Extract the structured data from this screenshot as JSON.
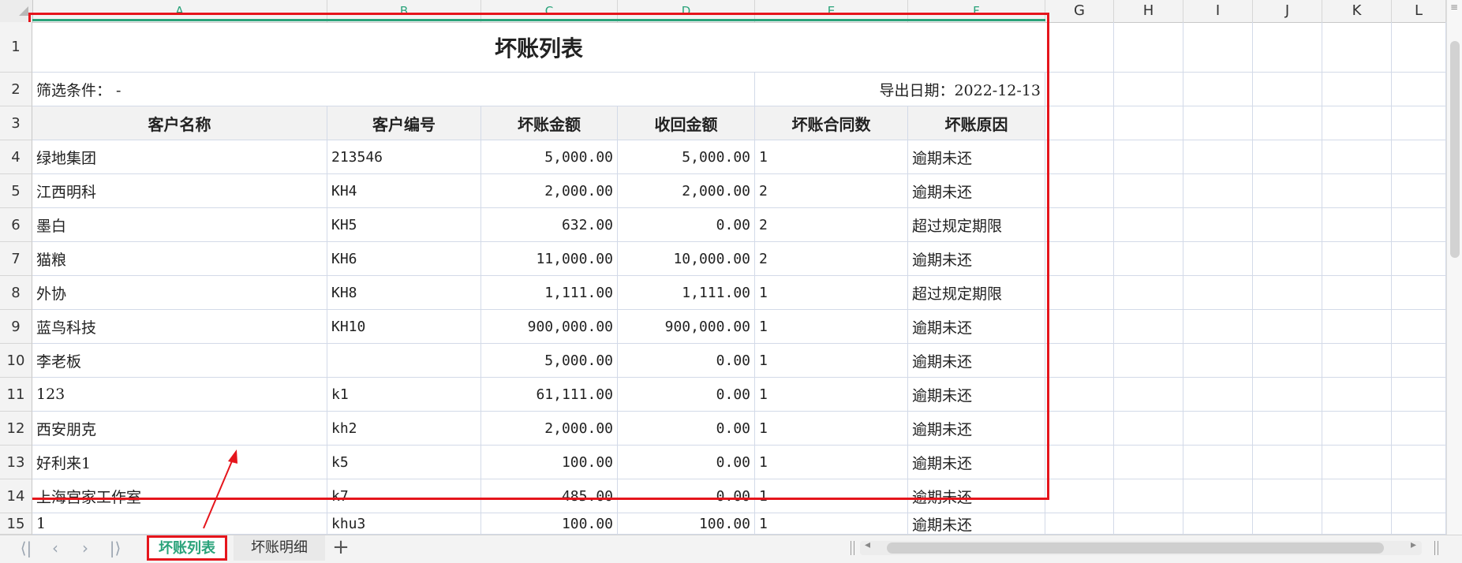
{
  "columns": [
    "A",
    "B",
    "C",
    "D",
    "E",
    "F",
    "G",
    "H",
    "I",
    "J",
    "K",
    "L"
  ],
  "rows": [
    "1",
    "2",
    "3",
    "4",
    "5",
    "6",
    "7",
    "8",
    "9",
    "10",
    "11",
    "12",
    "13",
    "14",
    "15"
  ],
  "report": {
    "title": "坏账列表",
    "filter_label": "筛选条件： -",
    "export_date_label": "导出日期：2022-12-13",
    "headers": [
      "客户名称",
      "客户编号",
      "坏账金额",
      "收回金额",
      "坏账合同数",
      "坏账原因"
    ],
    "records": [
      [
        "绿地集团",
        "213546",
        "5,000.00",
        "5,000.00",
        "1",
        "逾期未还"
      ],
      [
        "江西明科",
        "KH4",
        "2,000.00",
        "2,000.00",
        "2",
        "逾期未还"
      ],
      [
        "墨白",
        "KH5",
        "632.00",
        "0.00",
        "2",
        "超过规定期限"
      ],
      [
        "猫粮",
        "KH6",
        "11,000.00",
        "10,000.00",
        "2",
        "逾期未还"
      ],
      [
        "外协",
        "KH8",
        "1,111.00",
        "1,111.00",
        "1",
        "超过规定期限"
      ],
      [
        "蓝鸟科技",
        "KH10",
        "900,000.00",
        "900,000.00",
        "1",
        "逾期未还"
      ],
      [
        "李老板",
        "",
        "5,000.00",
        "0.00",
        "1",
        "逾期未还"
      ],
      [
        "123",
        "k1",
        "61,111.00",
        "0.00",
        "1",
        "逾期未还"
      ],
      [
        "西安朋克",
        "kh2",
        "2,000.00",
        "0.00",
        "1",
        "逾期未还"
      ],
      [
        "好利来1",
        "k5",
        "100.00",
        "0.00",
        "1",
        "逾期未还"
      ],
      [
        "上海宫家工作室",
        "k7",
        "485.00",
        "0.00",
        "1",
        "逾期未还"
      ],
      [
        "1",
        "khu3",
        "100.00",
        "100.00",
        "1",
        "逾期未还"
      ]
    ]
  },
  "sheet_tabs": [
    {
      "label": "坏账列表",
      "active": true
    },
    {
      "label": "坏账明细",
      "active": false
    }
  ],
  "icons": {
    "first": "⟨|",
    "prev": "‹",
    "next": "›",
    "last": "|⟩",
    "add": "+",
    "menu": "≡"
  },
  "colors": {
    "accent": "#2aa37a",
    "annotation": "#e5151c"
  }
}
